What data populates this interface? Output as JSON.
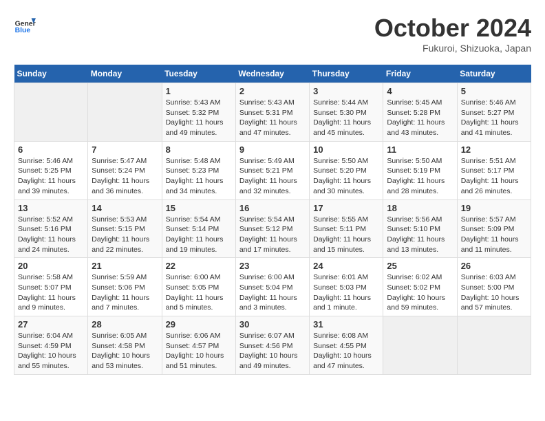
{
  "app": {
    "name": "GeneralBlue",
    "title": "October 2024",
    "subtitle": "Fukuroi, Shizuoka, Japan"
  },
  "weekdays": [
    "Sunday",
    "Monday",
    "Tuesday",
    "Wednesday",
    "Thursday",
    "Friday",
    "Saturday"
  ],
  "weeks": [
    [
      {
        "day": null
      },
      {
        "day": null
      },
      {
        "day": "1",
        "sunrise": "5:43 AM",
        "sunset": "5:32 PM",
        "daylight": "11 hours and 49 minutes."
      },
      {
        "day": "2",
        "sunrise": "5:43 AM",
        "sunset": "5:31 PM",
        "daylight": "11 hours and 47 minutes."
      },
      {
        "day": "3",
        "sunrise": "5:44 AM",
        "sunset": "5:30 PM",
        "daylight": "11 hours and 45 minutes."
      },
      {
        "day": "4",
        "sunrise": "5:45 AM",
        "sunset": "5:28 PM",
        "daylight": "11 hours and 43 minutes."
      },
      {
        "day": "5",
        "sunrise": "5:46 AM",
        "sunset": "5:27 PM",
        "daylight": "11 hours and 41 minutes."
      }
    ],
    [
      {
        "day": "6",
        "sunrise": "5:46 AM",
        "sunset": "5:25 PM",
        "daylight": "11 hours and 39 minutes."
      },
      {
        "day": "7",
        "sunrise": "5:47 AM",
        "sunset": "5:24 PM",
        "daylight": "11 hours and 36 minutes."
      },
      {
        "day": "8",
        "sunrise": "5:48 AM",
        "sunset": "5:23 PM",
        "daylight": "11 hours and 34 minutes."
      },
      {
        "day": "9",
        "sunrise": "5:49 AM",
        "sunset": "5:21 PM",
        "daylight": "11 hours and 32 minutes."
      },
      {
        "day": "10",
        "sunrise": "5:50 AM",
        "sunset": "5:20 PM",
        "daylight": "11 hours and 30 minutes."
      },
      {
        "day": "11",
        "sunrise": "5:50 AM",
        "sunset": "5:19 PM",
        "daylight": "11 hours and 28 minutes."
      },
      {
        "day": "12",
        "sunrise": "5:51 AM",
        "sunset": "5:17 PM",
        "daylight": "11 hours and 26 minutes."
      }
    ],
    [
      {
        "day": "13",
        "sunrise": "5:52 AM",
        "sunset": "5:16 PM",
        "daylight": "11 hours and 24 minutes."
      },
      {
        "day": "14",
        "sunrise": "5:53 AM",
        "sunset": "5:15 PM",
        "daylight": "11 hours and 22 minutes."
      },
      {
        "day": "15",
        "sunrise": "5:54 AM",
        "sunset": "5:14 PM",
        "daylight": "11 hours and 19 minutes."
      },
      {
        "day": "16",
        "sunrise": "5:54 AM",
        "sunset": "5:12 PM",
        "daylight": "11 hours and 17 minutes."
      },
      {
        "day": "17",
        "sunrise": "5:55 AM",
        "sunset": "5:11 PM",
        "daylight": "11 hours and 15 minutes."
      },
      {
        "day": "18",
        "sunrise": "5:56 AM",
        "sunset": "5:10 PM",
        "daylight": "11 hours and 13 minutes."
      },
      {
        "day": "19",
        "sunrise": "5:57 AM",
        "sunset": "5:09 PM",
        "daylight": "11 hours and 11 minutes."
      }
    ],
    [
      {
        "day": "20",
        "sunrise": "5:58 AM",
        "sunset": "5:07 PM",
        "daylight": "11 hours and 9 minutes."
      },
      {
        "day": "21",
        "sunrise": "5:59 AM",
        "sunset": "5:06 PM",
        "daylight": "11 hours and 7 minutes."
      },
      {
        "day": "22",
        "sunrise": "6:00 AM",
        "sunset": "5:05 PM",
        "daylight": "11 hours and 5 minutes."
      },
      {
        "day": "23",
        "sunrise": "6:00 AM",
        "sunset": "5:04 PM",
        "daylight": "11 hours and 3 minutes."
      },
      {
        "day": "24",
        "sunrise": "6:01 AM",
        "sunset": "5:03 PM",
        "daylight": "11 hours and 1 minute."
      },
      {
        "day": "25",
        "sunrise": "6:02 AM",
        "sunset": "5:02 PM",
        "daylight": "10 hours and 59 minutes."
      },
      {
        "day": "26",
        "sunrise": "6:03 AM",
        "sunset": "5:00 PM",
        "daylight": "10 hours and 57 minutes."
      }
    ],
    [
      {
        "day": "27",
        "sunrise": "6:04 AM",
        "sunset": "4:59 PM",
        "daylight": "10 hours and 55 minutes."
      },
      {
        "day": "28",
        "sunrise": "6:05 AM",
        "sunset": "4:58 PM",
        "daylight": "10 hours and 53 minutes."
      },
      {
        "day": "29",
        "sunrise": "6:06 AM",
        "sunset": "4:57 PM",
        "daylight": "10 hours and 51 minutes."
      },
      {
        "day": "30",
        "sunrise": "6:07 AM",
        "sunset": "4:56 PM",
        "daylight": "10 hours and 49 minutes."
      },
      {
        "day": "31",
        "sunrise": "6:08 AM",
        "sunset": "4:55 PM",
        "daylight": "10 hours and 47 minutes."
      },
      {
        "day": null
      },
      {
        "day": null
      }
    ]
  ]
}
